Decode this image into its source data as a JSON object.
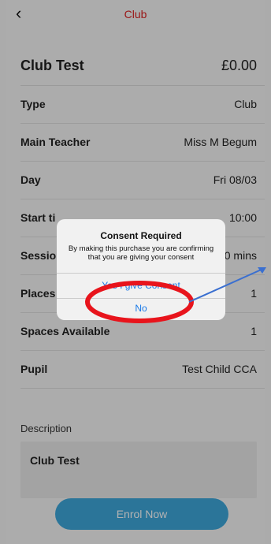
{
  "header": {
    "back_glyph": "‹",
    "title": "Club"
  },
  "summary": {
    "title": "Club Test",
    "price": "£0.00"
  },
  "details": [
    {
      "label": "Type",
      "value": "Club"
    },
    {
      "label": "Main Teacher",
      "value": "Miss M Begum"
    },
    {
      "label": "Day",
      "value": "Fri 08/03"
    },
    {
      "label": "Start ti",
      "value": "10:00"
    },
    {
      "label": "Session",
      "value": ")0 mins"
    },
    {
      "label": "Places",
      "value": "1"
    },
    {
      "label": "Spaces Available",
      "value": "1"
    },
    {
      "label": "Pupil",
      "value": "Test Child CCA"
    }
  ],
  "description": {
    "label": "Description",
    "text": "Club Test"
  },
  "enrol_button": "Enrol Now",
  "alert": {
    "title": "Consent Required",
    "message": "By making this purchase you are confirming that you are giving your consent",
    "confirm_label": "Yes I give Consent",
    "decline_label": "No"
  },
  "annotation": {
    "circle_color": "#e8141c",
    "arrow_color": "#3a6fd0"
  }
}
